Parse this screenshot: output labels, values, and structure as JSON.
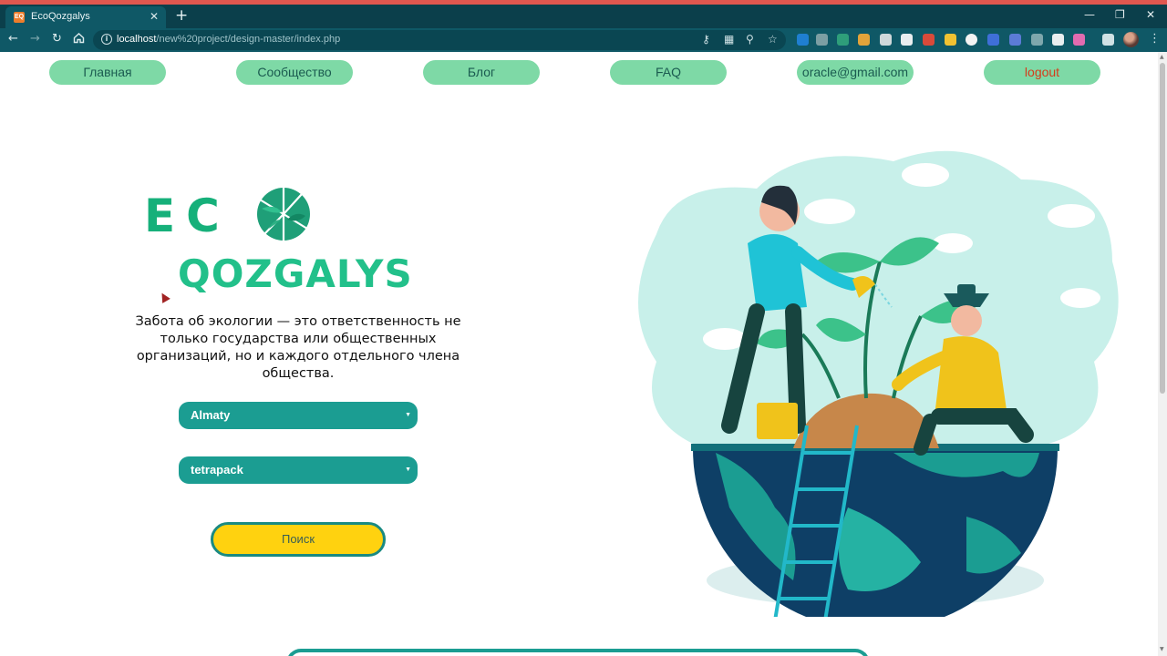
{
  "browser": {
    "tab_title": "EcoQozgalys",
    "tab_favicon": "EQ",
    "tab_close": "✕",
    "new_tab": "+",
    "url_host": "localhost",
    "url_path": "/new%20project/design-master/index.php",
    "win_minimize": "—",
    "win_restore": "❐",
    "win_close": "✕"
  },
  "nav": {
    "items": [
      "Главная",
      "Сообщество",
      "Блог",
      "FAQ",
      "oracle@gmail.com",
      "logout"
    ]
  },
  "logo": {
    "line1": "EC",
    "line2": "QOZGALYS"
  },
  "tagline": "Забота об экологии — это ответственность не только государства или общественных организаций, но и каждого отдельного члена общества.",
  "filters": {
    "city": "Almaty",
    "waste_type": "tetrapack"
  },
  "search_button": "Поиск",
  "colors": {
    "accent_green": "#7ed9a6",
    "select_teal": "#1b9d92",
    "button_yellow": "#ffd20f",
    "logo_green": "#16b07a",
    "logout_red": "#d63b1a"
  }
}
